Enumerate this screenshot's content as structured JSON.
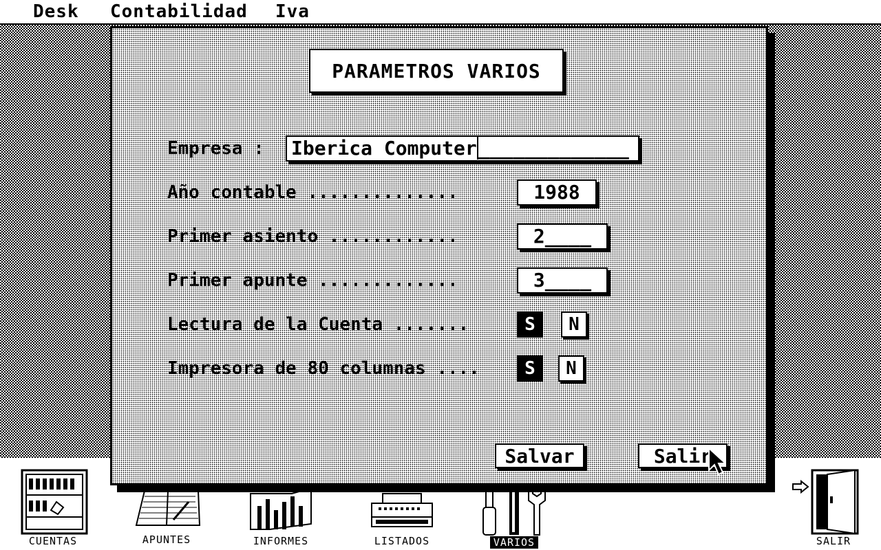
{
  "menu": {
    "items": [
      {
        "label": "Desk"
      },
      {
        "label": "Contabilidad"
      },
      {
        "label": "Iva"
      }
    ]
  },
  "dialog": {
    "title": "PARAMETROS VARIOS",
    "empresa": {
      "label": "Empresa :",
      "value": "Iberica Computer",
      "mask": "_____________"
    },
    "ano": {
      "label": "Año contable ..............",
      "value": "1988"
    },
    "asiento": {
      "label": "Primer asiento ............",
      "value": "2____"
    },
    "apunte": {
      "label": "Primer apunte .............",
      "value": "3____"
    },
    "lectura": {
      "label": "Lectura de la Cuenta .......",
      "yes": "S",
      "no": "N",
      "selected": "S"
    },
    "impresora": {
      "label": "Impresora de 80 columnas ....",
      "yes": "S",
      "no": "N",
      "selected": "S"
    },
    "save_label": "Salvar",
    "exit_label": "Salir"
  },
  "dock": {
    "items": [
      {
        "label": "CUENTAS"
      },
      {
        "label": "APUNTES"
      },
      {
        "label": "INFORMES"
      },
      {
        "label": "LISTADOS"
      },
      {
        "label": "VARIOS",
        "active": true
      },
      {
        "label": "SALIR"
      }
    ]
  }
}
